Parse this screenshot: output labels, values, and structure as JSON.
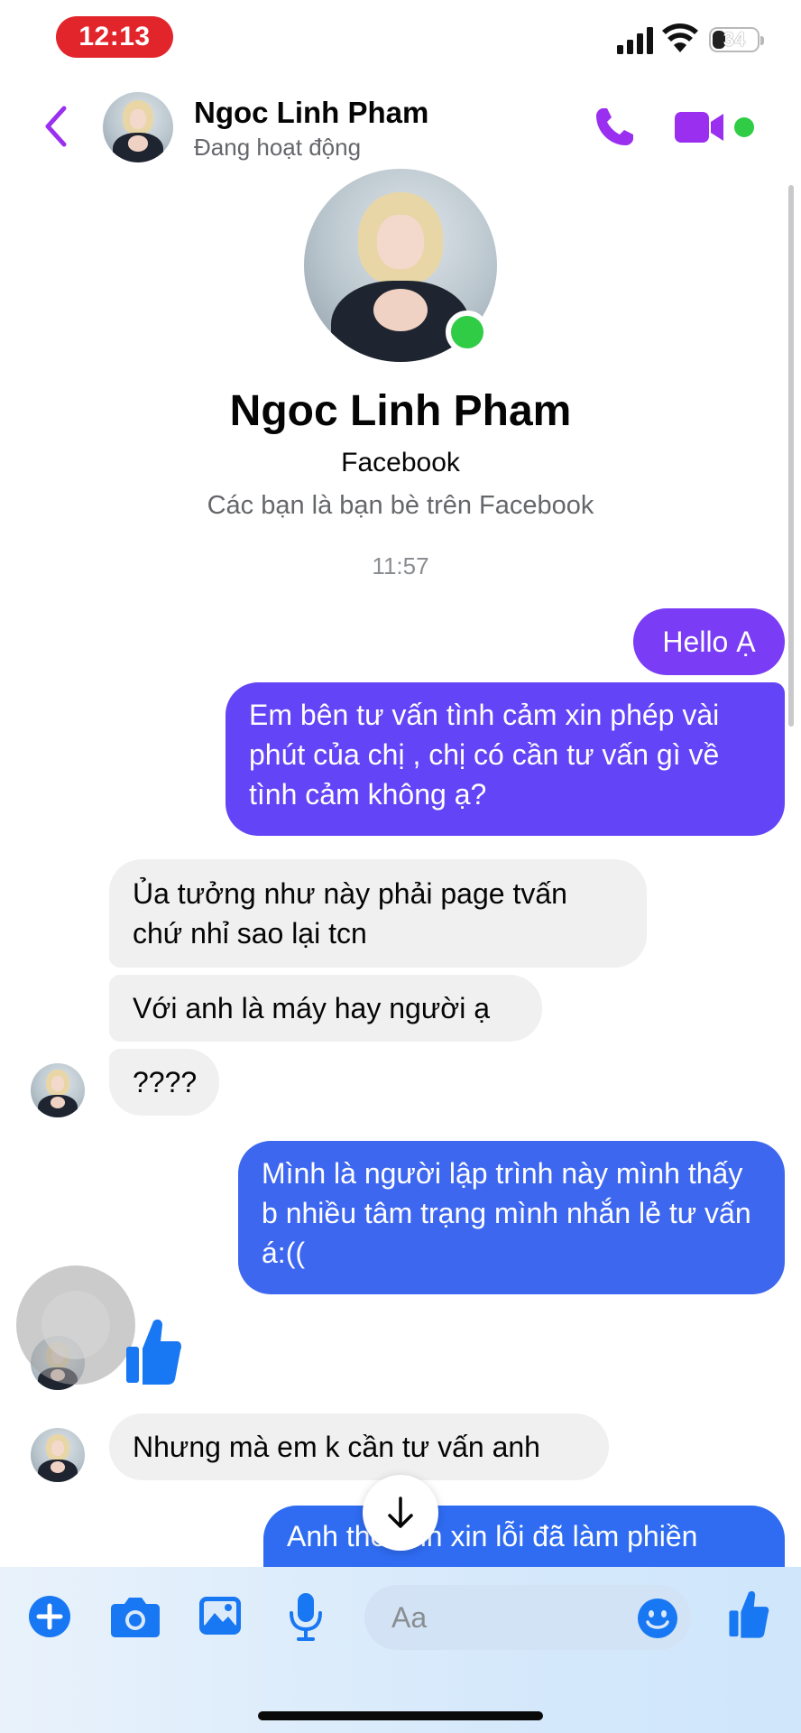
{
  "status_bar": {
    "time": "12:13",
    "battery": "34",
    "battery_level": 0.34
  },
  "header": {
    "contact_name": "Ngoc Linh Pham",
    "contact_status": "Đang hoạt động"
  },
  "profile": {
    "name": "Ngoc Linh Pham",
    "app": "Facebook",
    "relationship_note": "Các bạn là bạn bè trên Facebook"
  },
  "thread": {
    "timestamp": "11:57",
    "messages": [
      {
        "sender": "me",
        "text": "Hello Ạ"
      },
      {
        "sender": "me",
        "text": "Em bên tư vấn tình cảm xin phép vài phút của chị , chị có cần tư vấn gì về tình cảm không ạ?"
      },
      {
        "sender": "them",
        "text": "Ủa tưởng như này phải page tvấn chứ nhỉ sao lại tcn"
      },
      {
        "sender": "them",
        "text": "Với anh là máy hay người ạ"
      },
      {
        "sender": "them",
        "text": "????"
      },
      {
        "sender": "me",
        "text": "Mình là người lập trình này mình thấy b nhiều tâm trạng mình nhắn lẻ tư vấn á:(("
      },
      {
        "sender": "them",
        "text": "Nhưng mà em k cần tư vấn anh"
      },
      {
        "sender": "me",
        "text": "Anh thế anh xin lỗi đã làm phiền"
      }
    ],
    "reaction_icon": "thumbs-up-icon"
  },
  "composer": {
    "placeholder": "Aa"
  },
  "colors": {
    "accent": "#9a2ff0",
    "messenger_blue": "#1877f2",
    "online_green": "#31cc46",
    "bubble_incoming": "#f0f0f0",
    "status_time_pill": "#e2252b"
  },
  "icons": {
    "back": "chevron-left-icon",
    "call": "phone-icon",
    "video": "video-camera-icon",
    "plus": "plus-icon",
    "camera": "camera-icon",
    "gallery": "image-icon",
    "mic": "microphone-icon",
    "emoji": "smiley-icon",
    "like": "thumbs-up-icon",
    "scroll_down": "arrow-down-icon"
  }
}
